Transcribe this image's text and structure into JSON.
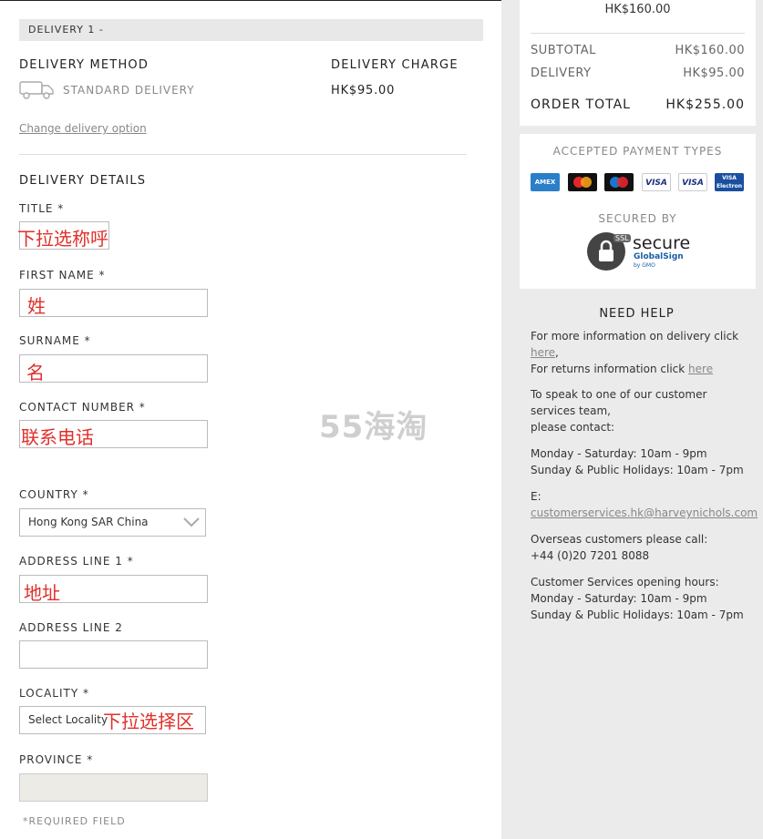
{
  "delivery": {
    "bar_label": "DELIVERY 1 -",
    "method_heading": "DELIVERY METHOD",
    "charge_heading": "DELIVERY CHARGE",
    "method_value": "STANDARD DELIVERY",
    "charge_value": "HK$95.00",
    "change_link": "Change delivery option"
  },
  "form": {
    "heading": "DELIVERY DETAILS",
    "title_label": "TITLE *",
    "title_annotation": "下拉选称呼",
    "first_name_label": "FIRST NAME *",
    "first_name_annotation": "姓",
    "surname_label": "SURNAME *",
    "surname_annotation": "名",
    "contact_label": "CONTACT NUMBER *",
    "contact_annotation": "联系电话",
    "country_label": "COUNTRY  *",
    "country_value": "Hong Kong SAR China",
    "address1_label": "ADDRESS LINE 1  *",
    "address1_annotation": "地址",
    "address2_label": "ADDRESS LINE 2",
    "locality_label": "LOCALITY  *",
    "locality_value": "Select Locality",
    "locality_annotation": "下拉选择区",
    "province_label": "PROVINCE  *",
    "required_note": "*REQUIRED FIELD"
  },
  "watermark": "55海淘",
  "summary": {
    "top_amount": "HK$160.00",
    "subtotal_label": "SUBTOTAL",
    "subtotal_value": "HK$160.00",
    "delivery_label": "DELIVERY",
    "delivery_value": "HK$95.00",
    "total_label": "ORDER TOTAL",
    "total_value": "HK$255.00"
  },
  "payment": {
    "heading": "ACCEPTED PAYMENT TYPES",
    "secured_by": "SECURED BY",
    "cards": [
      "AMEX",
      "MC",
      "Maestro",
      "VISA",
      "VISA",
      "VISA Electron"
    ],
    "ssl_badge": "SSL",
    "ssl_main": "secure",
    "ssl_sub": "GlobalSign",
    "ssl_by": "by GMO"
  },
  "help": {
    "heading": "NEED HELP",
    "delivery_text": "For more information on delivery click",
    "here1": "here",
    "returns_text": "For returns information click",
    "here2": "here",
    "speak_text": "To speak to one of our customer services team,",
    "please_contact": "please contact:",
    "hours1": "Monday - Saturday: 10am - 9pm",
    "hours2": "Sunday & Public Holidays: 10am - 7pm",
    "email_prefix": "E:",
    "email": "customerservices.hk@harveynichols.com",
    "overseas": "Overseas customers please call:",
    "phone": "+44 (0)20 7201 8088",
    "cs_hours_heading": "Customer Services opening hours:",
    "cs_hours1": "Monday - Saturday: 10am - 9pm",
    "cs_hours2": "Sunday & Public Holidays: 10am - 7pm"
  },
  "colors": {
    "annotation": "#e0302b",
    "sidebar_bg": "#ebebeb"
  }
}
